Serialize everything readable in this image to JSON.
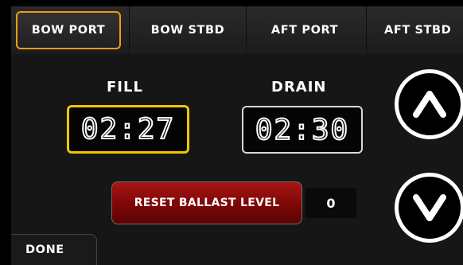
{
  "tabs": [
    {
      "label": "BOW PORT",
      "active": true
    },
    {
      "label": "BOW STBD",
      "active": false
    },
    {
      "label": "AFT PORT",
      "active": false
    },
    {
      "label": "AFT STBD",
      "active": false
    }
  ],
  "fill": {
    "label": "FILL",
    "time": "02:27"
  },
  "drain": {
    "label": "DRAIN",
    "time": "02:30"
  },
  "reset": {
    "label": "RESET BALLAST LEVEL",
    "level": "0"
  },
  "controls": {
    "up_icon": "chevron-up-icon",
    "down_icon": "chevron-down-icon"
  },
  "done": {
    "label": "DONE"
  },
  "colors": {
    "active_tab_border": "#f29a18",
    "fill_border": "#f2c500",
    "reset_button": "#8f0c0c",
    "background": "#000000"
  }
}
